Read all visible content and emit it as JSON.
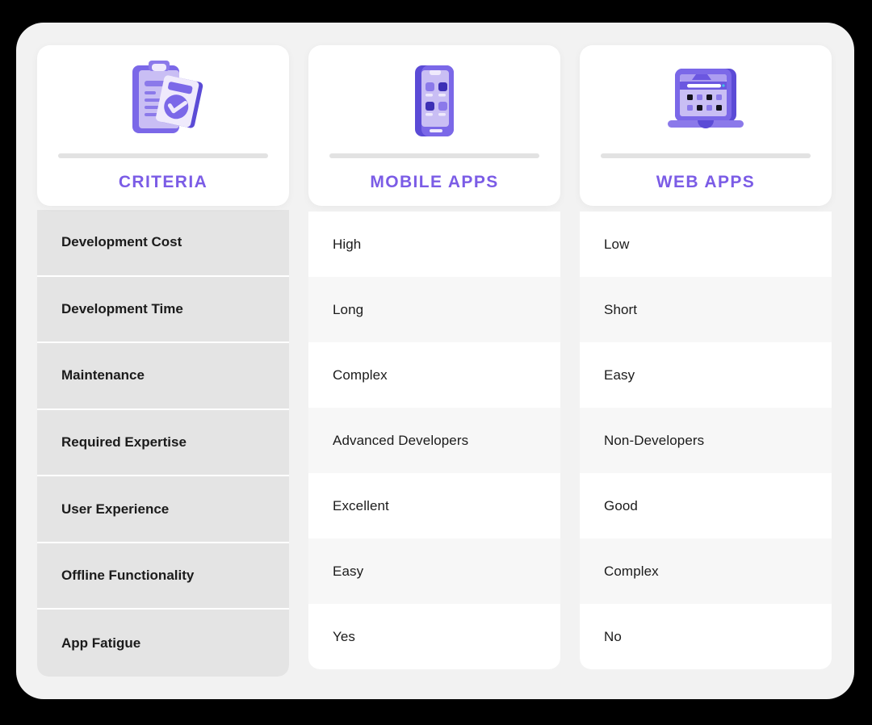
{
  "theme": {
    "accent": "#7b5ce6",
    "icon_dark_purple": "#5b4bd6",
    "icon_mid_purple": "#8b79ea",
    "icon_light_purple": "#c7bdf2",
    "icon_pale": "#ece9fb",
    "criteria_row_bg": "#e4e4e4",
    "value_row_alt_bg": "#f7f7f7",
    "page_bg": "#f2f2f2"
  },
  "columns": [
    {
      "key": "criteria",
      "title": "CRITERIA",
      "icon": "clipboard-checklist-icon"
    },
    {
      "key": "mobile",
      "title": "MOBILE APPS",
      "icon": "mobile-phone-icon"
    },
    {
      "key": "web",
      "title": "WEB APPS",
      "icon": "laptop-browser-icon"
    }
  ],
  "rows": [
    {
      "criteria": "Development Cost",
      "mobile": "High",
      "web": "Low"
    },
    {
      "criteria": "Development Time",
      "mobile": "Long",
      "web": "Short"
    },
    {
      "criteria": "Maintenance",
      "mobile": "Complex",
      "web": "Easy"
    },
    {
      "criteria": "Required Expertise",
      "mobile": "Advanced Developers",
      "web": "Non-Developers"
    },
    {
      "criteria": "User Experience",
      "mobile": "Excellent",
      "web": "Good"
    },
    {
      "criteria": "Offline Functionality",
      "mobile": "Easy",
      "web": "Complex"
    },
    {
      "criteria": "App Fatigue",
      "mobile": "Yes",
      "web": "No"
    }
  ]
}
